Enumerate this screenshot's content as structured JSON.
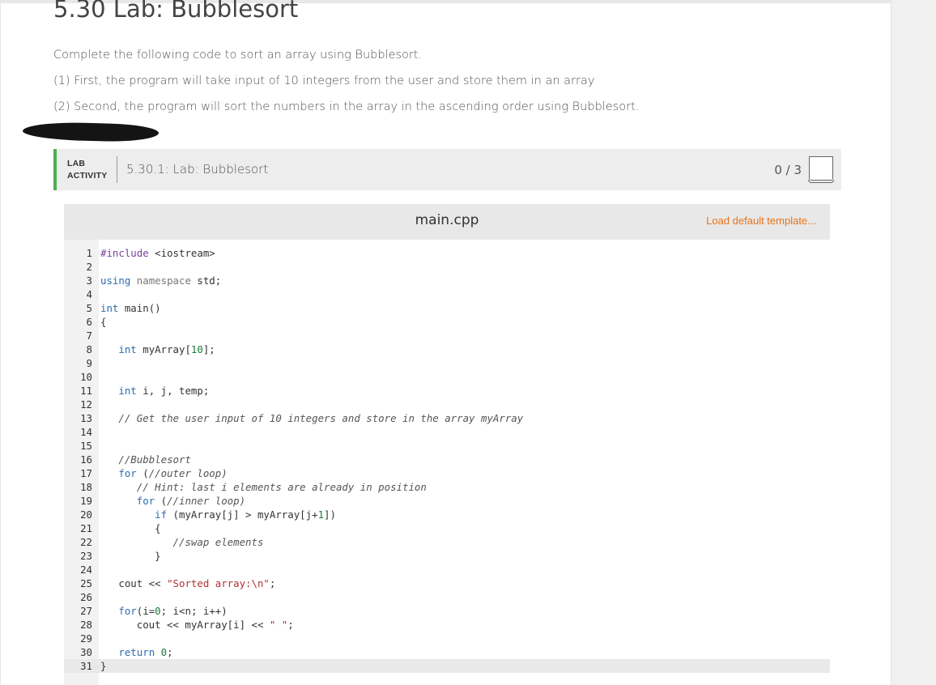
{
  "page": {
    "title": "5.30 Lab: Bubblesort",
    "intro": "Complete the following code to sort an array using Bubblesort.",
    "step1": "(1) First, the program will take input of 10 integers from the user and store them in an array",
    "step2": "(2) Second, the program will sort the numbers in the array in the ascending order using Bubblesort."
  },
  "lab": {
    "tag_line1": "LAB",
    "tag_line2": "ACTIVITY",
    "name": "5.30.1: Lab: Bubblesort",
    "score": "0 / 3",
    "accent_color": "#4caf50"
  },
  "editor": {
    "file_name": "main.cpp",
    "load_template": "Load default template...",
    "link_color": "#e8731a",
    "lines": [
      "#include <iostream>",
      "",
      "using namespace std;",
      "",
      "int main()",
      "{",
      "",
      "   int myArray[10];",
      "",
      "",
      "   int i, j, temp;",
      "",
      "   // Get the user input of 10 integers and store in the array myArray",
      "",
      "",
      "   //Bubblesort",
      "   for (//outer loop)",
      "      // Hint: last i elements are already in position",
      "      for (//inner loop)",
      "         if (myArray[j] > myArray[j+1])",
      "         {",
      "            //swap elements",
      "         }",
      "",
      "   cout << \"Sorted array:\\n\";",
      "",
      "   for(i=0; i<n; i++)",
      "      cout << myArray[i] << \" \";",
      "",
      "   return 0;",
      "}"
    ]
  },
  "icons": {
    "score_box": "checkbox-icon"
  }
}
